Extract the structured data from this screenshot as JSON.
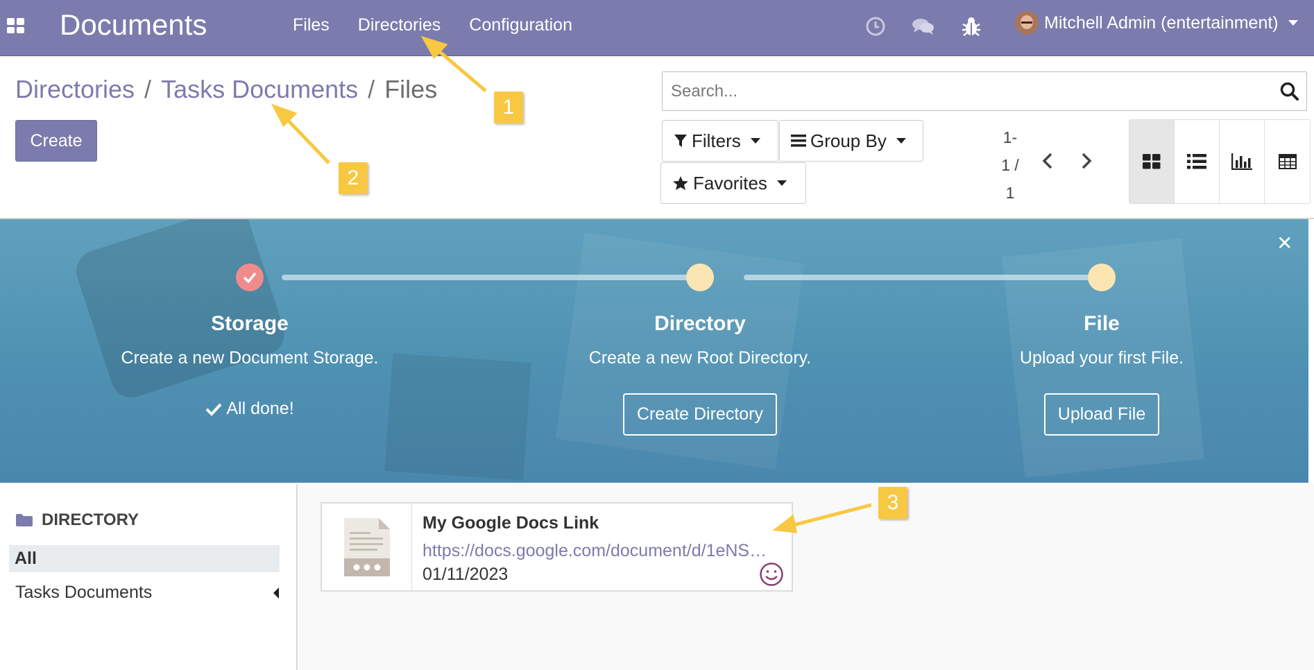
{
  "topbar": {
    "app_name": "Documents",
    "menu": [
      "Files",
      "Directories",
      "Configuration"
    ],
    "user": "Mitchell Admin (entertainment)",
    "color": "#7c7bad"
  },
  "breadcrumb": {
    "items": [
      "Directories",
      "Tasks Documents"
    ],
    "separator": "/",
    "current": "Files"
  },
  "actions": {
    "create_label": "Create"
  },
  "search": {
    "placeholder": "Search..."
  },
  "search_options": {
    "filters": "Filters",
    "group_by": "Group By",
    "favorites": "Favorites"
  },
  "pager": {
    "line1": "1-",
    "line2": "1 /",
    "line3": "1"
  },
  "views": [
    "kanban-icon",
    "list-icon",
    "graph-icon",
    "pivot-icon"
  ],
  "banner": {
    "steps": [
      {
        "title": "Storage",
        "desc": "Create a new Document Storage.",
        "done_label": "All done!"
      },
      {
        "title": "Directory",
        "desc": "Create a new Root Directory.",
        "button": "Create Directory"
      },
      {
        "title": "File",
        "desc": "Upload your first File.",
        "button": "Upload File"
      }
    ]
  },
  "sidepanel": {
    "header": "DIRECTORY",
    "items": [
      "All",
      "Tasks Documents"
    ]
  },
  "card": {
    "title": "My Google Docs Link",
    "url": "https://docs.google.com/document/d/1eNS…",
    "date": "01/11/2023"
  },
  "annotations": [
    "1",
    "2",
    "3"
  ],
  "annotation_color": "#f8c842"
}
